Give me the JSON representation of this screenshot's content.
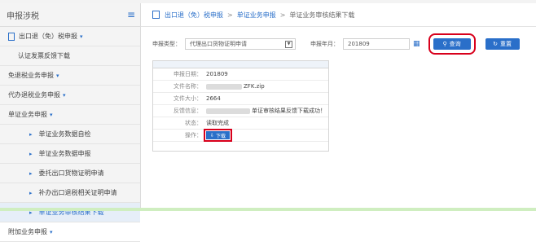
{
  "sidebar": {
    "title": "申报涉税",
    "items": [
      {
        "label": "出口退（免）税申报",
        "caret": "▾"
      },
      {
        "label": "认证发票反馈下载"
      },
      {
        "label": "免退税业务申报",
        "caret": "▾"
      },
      {
        "label": "代办退税业务申报",
        "caret": "▾"
      },
      {
        "label": "单证业务申报",
        "caret": "▾"
      },
      {
        "label": "单证业务数据自检"
      },
      {
        "label": "单证业务数据申报"
      },
      {
        "label": "委托出口货物证明申请"
      },
      {
        "label": "补办出口退税相关证明申请"
      },
      {
        "label": "单证业务审核结果下载"
      },
      {
        "label": "附加业务申报",
        "caret": "▾"
      }
    ]
  },
  "breadcrumb": {
    "items": [
      "出口退（免）税申报",
      "单证业务申报",
      "单证业务审核结果下载"
    ]
  },
  "filter": {
    "type_label": "申报类型：",
    "type_value": "代理出口货物证明申请",
    "period_label": "申报年月：",
    "period_value": "201809",
    "query_label": "查询",
    "reset_label": "重置"
  },
  "details": [
    {
      "key": "申报日期：",
      "value": "201809"
    },
    {
      "key": "文件名称：",
      "value": "ZFK.zip"
    },
    {
      "key": "文件大小：",
      "value": "2664"
    },
    {
      "key": "反馈信息：",
      "value": "单证审核结果反馈下载成功！"
    },
    {
      "key": "状态：",
      "value": "读取完成"
    },
    {
      "key": "操作：",
      "value": ""
    }
  ],
  "download_label": "下载",
  "colors": {
    "accent": "#2a6fc9",
    "highlight": "#d8001c"
  }
}
